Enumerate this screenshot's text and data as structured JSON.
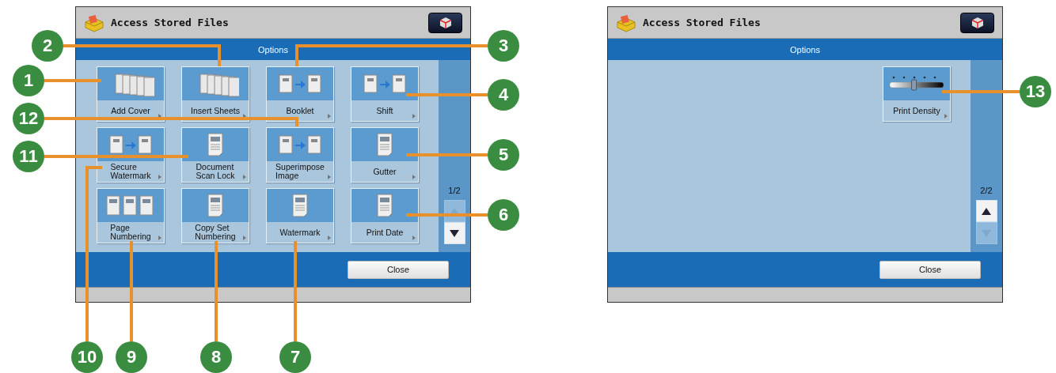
{
  "screens": [
    {
      "title": "Access Stored Files",
      "subtitle": "Options",
      "page": "1/2",
      "up_disabled": true,
      "down_disabled": false,
      "close": "Close",
      "buttons": [
        {
          "label": "Add Cover",
          "kind": "stack"
        },
        {
          "label": "Insert Sheets",
          "kind": "stack"
        },
        {
          "label": "Booklet",
          "kind": "convert"
        },
        {
          "label": "Shift",
          "kind": "convert"
        },
        {
          "label": "Secure\nWatermark",
          "kind": "convert"
        },
        {
          "label": "Document\nScan Lock",
          "kind": "page"
        },
        {
          "label": "Superimpose\nImage",
          "kind": "convert"
        },
        {
          "label": "Gutter",
          "kind": "page"
        },
        {
          "label": "Page\nNumbering",
          "kind": "triple"
        },
        {
          "label": "Copy Set\nNumbering",
          "kind": "page"
        },
        {
          "label": "Watermark",
          "kind": "page"
        },
        {
          "label": "Print Date",
          "kind": "page"
        }
      ]
    },
    {
      "title": "Access Stored Files",
      "subtitle": "Options",
      "page": "2/2",
      "up_disabled": false,
      "down_disabled": true,
      "close": "Close",
      "buttons": [
        {
          "label": "Print Density",
          "kind": "slider",
          "level": 0.45
        }
      ]
    }
  ],
  "callouts": [
    {
      "number": "2"
    },
    {
      "number": "3"
    },
    {
      "number": "1"
    },
    {
      "number": "4"
    },
    {
      "number": "12"
    },
    {
      "number": "11"
    },
    {
      "number": "5"
    },
    {
      "number": "6"
    },
    {
      "number": "10"
    },
    {
      "number": "9"
    },
    {
      "number": "8"
    },
    {
      "number": "7"
    },
    {
      "number": "13"
    }
  ]
}
